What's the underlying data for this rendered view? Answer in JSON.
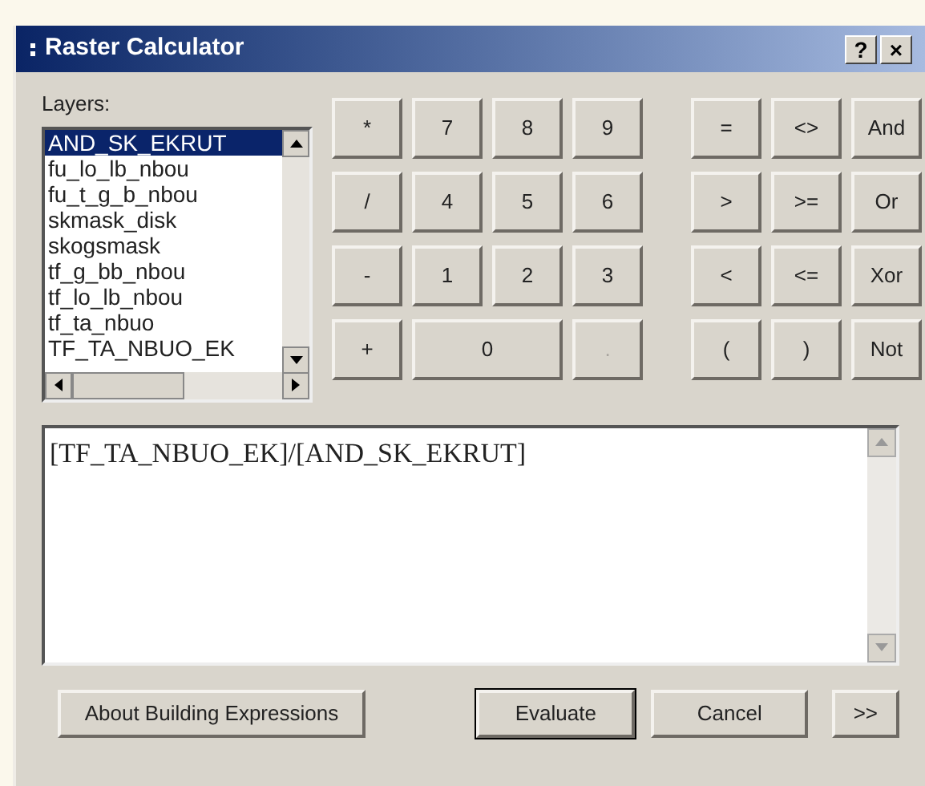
{
  "window": {
    "title": "Raster Calculator",
    "title_buttons": [
      "?",
      "×"
    ]
  },
  "layers": {
    "label": "Layers:",
    "items": [
      {
        "name": "AND_SK_EKRUT",
        "selected": true
      },
      {
        "name": "fu_lo_lb_nbou",
        "selected": false
      },
      {
        "name": "fu_t_g_b_nbou",
        "selected": false
      },
      {
        "name": "skmask_disk",
        "selected": false
      },
      {
        "name": "skogsmask",
        "selected": false
      },
      {
        "name": "tf_g_bb_nbou",
        "selected": false
      },
      {
        "name": "tf_lo_lb_nbou",
        "selected": false
      },
      {
        "name": "tf_ta_nbuo",
        "selected": false
      },
      {
        "name": "TF_TA_NBUO_EK",
        "selected": false
      }
    ]
  },
  "keypad": [
    [
      {
        "label": "*"
      },
      {
        "label": "7"
      },
      {
        "label": "8"
      },
      {
        "label": "9"
      },
      {
        "label": "="
      },
      {
        "label": "<>"
      },
      {
        "label": "And"
      }
    ],
    [
      {
        "label": "/"
      },
      {
        "label": "4"
      },
      {
        "label": "5"
      },
      {
        "label": "6"
      },
      {
        "label": ">"
      },
      {
        "label": ">="
      },
      {
        "label": "Or"
      }
    ],
    [
      {
        "label": "-"
      },
      {
        "label": "1"
      },
      {
        "label": "2"
      },
      {
        "label": "3"
      },
      {
        "label": "<"
      },
      {
        "label": "<="
      },
      {
        "label": "Xor"
      }
    ],
    [
      {
        "label": "+"
      },
      {
        "label": "0",
        "wide": true
      },
      {
        "label": ".",
        "disabled": true
      },
      {
        "label": "("
      },
      {
        "label": ")"
      },
      {
        "label": "Not"
      }
    ]
  ],
  "expression": "[TF_TA_NBUO_EK]/[AND_SK_EKRUT]",
  "buttons": [
    {
      "label": "About Building Expressions",
      "default": false
    },
    {
      "label": "Evaluate",
      "default": true
    },
    {
      "label": "Cancel",
      "default": false
    },
    {
      "label": ">>",
      "default": false
    }
  ]
}
